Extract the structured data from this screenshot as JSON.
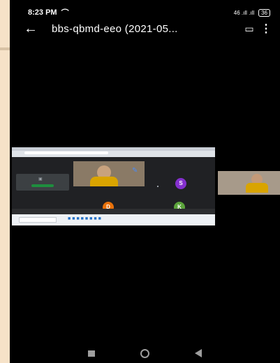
{
  "status_bar": {
    "time": "8:23 PM",
    "call_indicator": "⌒",
    "signal": "46 .ıll .ıll",
    "battery": "36"
  },
  "app_bar": {
    "back_icon": "←",
    "title": "bbs-qbmd-eeo (2021-05...",
    "captions_icon": "▭",
    "menu_icon": "⋮"
  },
  "shared_screen": {
    "avatars": {
      "s": "S",
      "d": "D",
      "k": "K"
    },
    "pencil": "✎",
    "left_panel_icon": "▣",
    "taskbar_icons": "■■■■■■■■"
  },
  "colors": {
    "background": "#000000",
    "frame": "#f6e2c8",
    "avatar_s": "#8430ce",
    "avatar_d": "#e8710a",
    "avatar_k": "#5ba33b",
    "scarf": "#d9a400"
  },
  "icons": {
    "back": "arrow-left-icon",
    "captions": "captions-icon",
    "menu": "more-vert-icon",
    "nav_recent": "square-icon",
    "nav_home": "circle-icon",
    "nav_back": "triangle-back-icon"
  }
}
